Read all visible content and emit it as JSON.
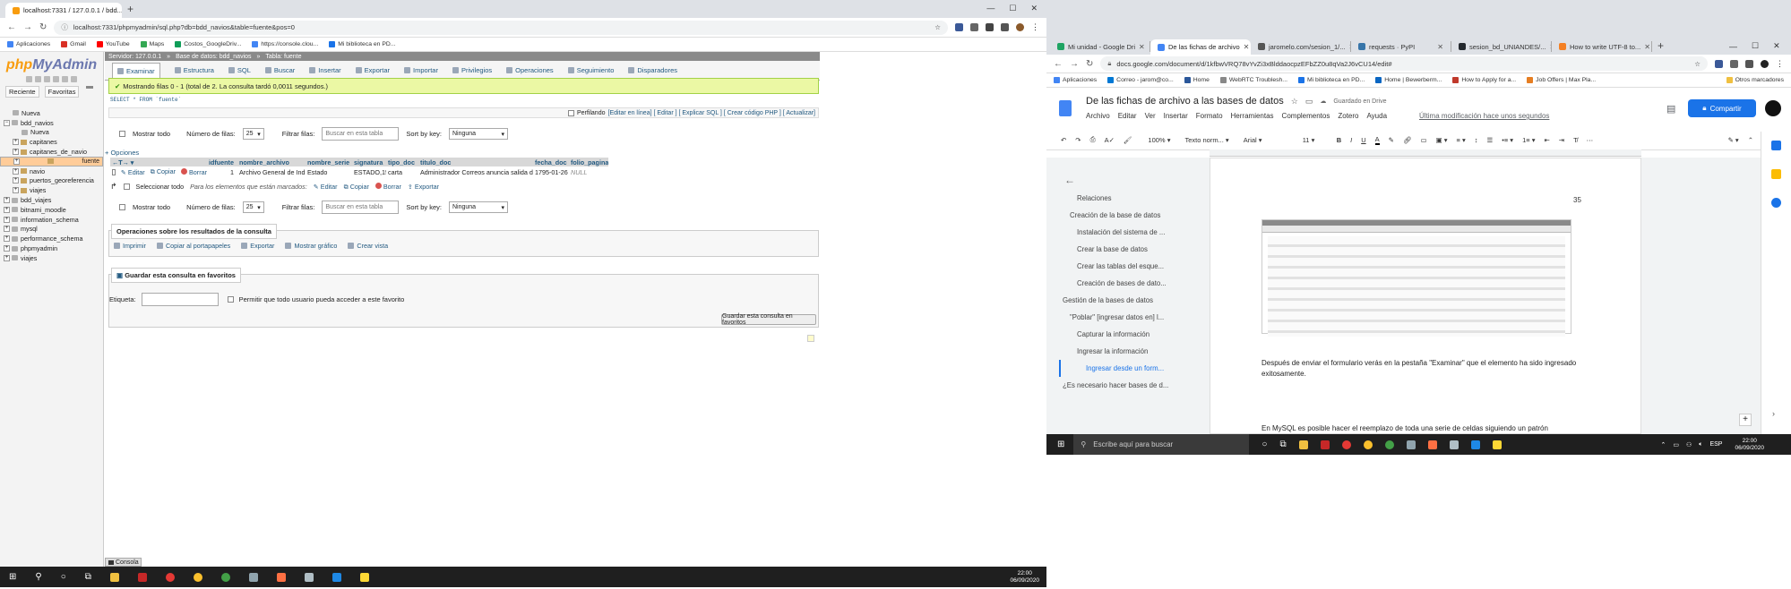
{
  "left_browser": {
    "tabs": [
      {
        "title": "localhost:7331 / 127.0.0.1 / bdd..."
      }
    ],
    "url": "localhost:7331/phpmyadmin/sql.php?db=bdd_navios&table=fuente&pos=0",
    "bookmarks": [
      "Aplicaciones",
      "Gmail",
      "YouTube",
      "Maps",
      "Costos_GoogleDriv...",
      "https://console.clou...",
      "Mi biblioteca en PD..."
    ]
  },
  "pma": {
    "logo_php": "php",
    "logo_myadmin": "MyAdmin",
    "side_tabs": [
      "Reciente",
      "Favoritas"
    ],
    "tree": [
      {
        "label": "Nueva",
        "indent": 1,
        "kind": "new"
      },
      {
        "label": "bdd_navios",
        "indent": 0,
        "kind": "db",
        "expanded": true
      },
      {
        "label": "Nueva",
        "indent": 2,
        "kind": "new"
      },
      {
        "label": "capitanes",
        "indent": 1,
        "kind": "table"
      },
      {
        "label": "capitanes_de_navio",
        "indent": 1,
        "kind": "table"
      },
      {
        "label": "fuente",
        "indent": 1,
        "kind": "table",
        "selected": true
      },
      {
        "label": "navio",
        "indent": 1,
        "kind": "table"
      },
      {
        "label": "puertos_georeferencia",
        "indent": 1,
        "kind": "table"
      },
      {
        "label": "viajes",
        "indent": 1,
        "kind": "table"
      },
      {
        "label": "bdd_viajes",
        "indent": 0,
        "kind": "db"
      },
      {
        "label": "bitnami_moodle",
        "indent": 0,
        "kind": "db"
      },
      {
        "label": "information_schema",
        "indent": 0,
        "kind": "db"
      },
      {
        "label": "mysql",
        "indent": 0,
        "kind": "db"
      },
      {
        "label": "performance_schema",
        "indent": 0,
        "kind": "db"
      },
      {
        "label": "phpmyadmin",
        "indent": 0,
        "kind": "db"
      },
      {
        "label": "viajes",
        "indent": 0,
        "kind": "db"
      }
    ],
    "breadcrumb": {
      "server": "Servidor: 127.0.0.1",
      "db": "Base de datos: bdd_navios",
      "table": "Tabla: fuente"
    },
    "menu_tabs": [
      "Examinar",
      "Estructura",
      "SQL",
      "Buscar",
      "Insertar",
      "Exportar",
      "Importar",
      "Privilegios",
      "Operaciones",
      "Seguimiento",
      "Disparadores"
    ],
    "success_msg": "Mostrando filas 0 - 1 (total de 2. La consulta tardó 0,0011 segundos.)",
    "sql_query": "SELECT * FROM `fuente`",
    "profiling": {
      "label": "Perfilando",
      "links": "[Editar en línea] [ Editar ] [ Explicar SQL ] [ Crear código PHP ] [ Actualizar]"
    },
    "controls": {
      "show_all": "Mostrar todo",
      "num_rows_label": "Número de filas:",
      "num_rows": "25",
      "filter_label": "Filtrar filas:",
      "filter_placeholder": "Buscar en esta tabla",
      "sort_label": "Sort by key:",
      "sort_value": "Ninguna"
    },
    "options_link": "+ Opciones",
    "columns": [
      "idfuente",
      "nombre_archivo",
      "nombre_serie",
      "signatura",
      "tipo_doc",
      "titulo_doc",
      "fecha_doc",
      "folio_pagina"
    ],
    "row_actions": [
      "Editar",
      "Copiar",
      "Borrar"
    ],
    "rows": [
      [
        "1",
        "Archivo General de Indias",
        "Estado",
        "ESTADO,15,N.25",
        "carta",
        "Administrador Correos anuncia salida del \"Pi",
        "1795-01-26",
        "NULL"
      ]
    ],
    "bulk": {
      "select_all": "Seleccionar todo",
      "marked": "Para los elementos que están marcados:",
      "actions": [
        "Editar",
        "Copiar",
        "Borrar",
        "Exportar"
      ]
    },
    "ops_section": {
      "title": "Operaciones sobre los resultados de la consulta",
      "items": [
        "Imprimir",
        "Copiar al portapapeles",
        "Exportar",
        "Mostrar gráfico",
        "Crear vista"
      ]
    },
    "bookmark_section": {
      "title": "Guardar esta consulta en favoritos",
      "label_field": "Etiqueta:",
      "allow_users": "Permitir que todo usuario pueda acceder a este favorito",
      "save_button": "Guardar esta consulta en favoritos"
    },
    "console": "Consola"
  },
  "left_taskbar": {
    "time": "22:00",
    "date": "06/09/2020"
  },
  "right_browser": {
    "tabs": [
      "Mi unidad - Google Dri",
      "De las fichas de archivo",
      "jaromelo.com/sesion_1/...",
      "requests · PyPI",
      "sesion_bd_UNIANDES/...",
      "How to write UTF-8 to..."
    ],
    "url": "docs.google.com/document/d/1kfbwVRQ78vYvZi3xBlddaocpzEFbZZ0u8qVa2J6vCU14/edit#",
    "bookmarks": [
      "Aplicaciones",
      "Correo - jarom@co...",
      "Home",
      "WebRTC Troublesh...",
      "Mi biblioteca en PD...",
      "Home | Bewerberm...",
      "How to Apply for a...",
      "Job Offers | Max Pla...",
      "Otros marcadores"
    ],
    "doc_title": "De las fichas de archivo a las bases de datos",
    "saved": "Guardado en Drive",
    "menus": [
      "Archivo",
      "Editar",
      "Ver",
      "Insertar",
      "Formato",
      "Herramientas",
      "Complementos",
      "Zotero",
      "Ayuda"
    ],
    "last_edit": "Última modificación hace unos segundos",
    "share": "Compartir",
    "toolbar": {
      "zoom": "100%",
      "style": "Texto norm...",
      "font": "Arial",
      "size": "11"
    },
    "outline": [
      {
        "text": "Relaciones",
        "level": 2
      },
      {
        "text": "Creación de la base de datos",
        "level": 1
      },
      {
        "text": "Instalación del sistema de ...",
        "level": 2
      },
      {
        "text": "Crear la base de datos",
        "level": 2
      },
      {
        "text": "Crear las tablas del esque...",
        "level": 2
      },
      {
        "text": "Creación de bases de dato...",
        "level": 2
      },
      {
        "text": "Gestión de la bases de datos",
        "level": 0
      },
      {
        "text": "\"Poblar\" [ingresar datos en] l...",
        "level": 1
      },
      {
        "text": "Capturar la información",
        "level": 2
      },
      {
        "text": "Ingresar la información",
        "level": 2
      },
      {
        "text": "Ingresar desde un form...",
        "level": 3,
        "active": true
      },
      {
        "text": "¿Es necesario hacer bases de d...",
        "level": 0
      }
    ],
    "page_number": "35",
    "para1": "Después de enviar el formulario verás en la pestaña \"Examinar\" que el elemento ha sido ingresado exitosamente.",
    "para2": "En MySQL es posible hacer el reemplazo de toda una serie de celdas siguiendo un patrón"
  },
  "right_taskbar": {
    "search": "Escribe aquí para buscar",
    "lang": "ESP",
    "time": "22:00",
    "date": "06/09/2020"
  }
}
